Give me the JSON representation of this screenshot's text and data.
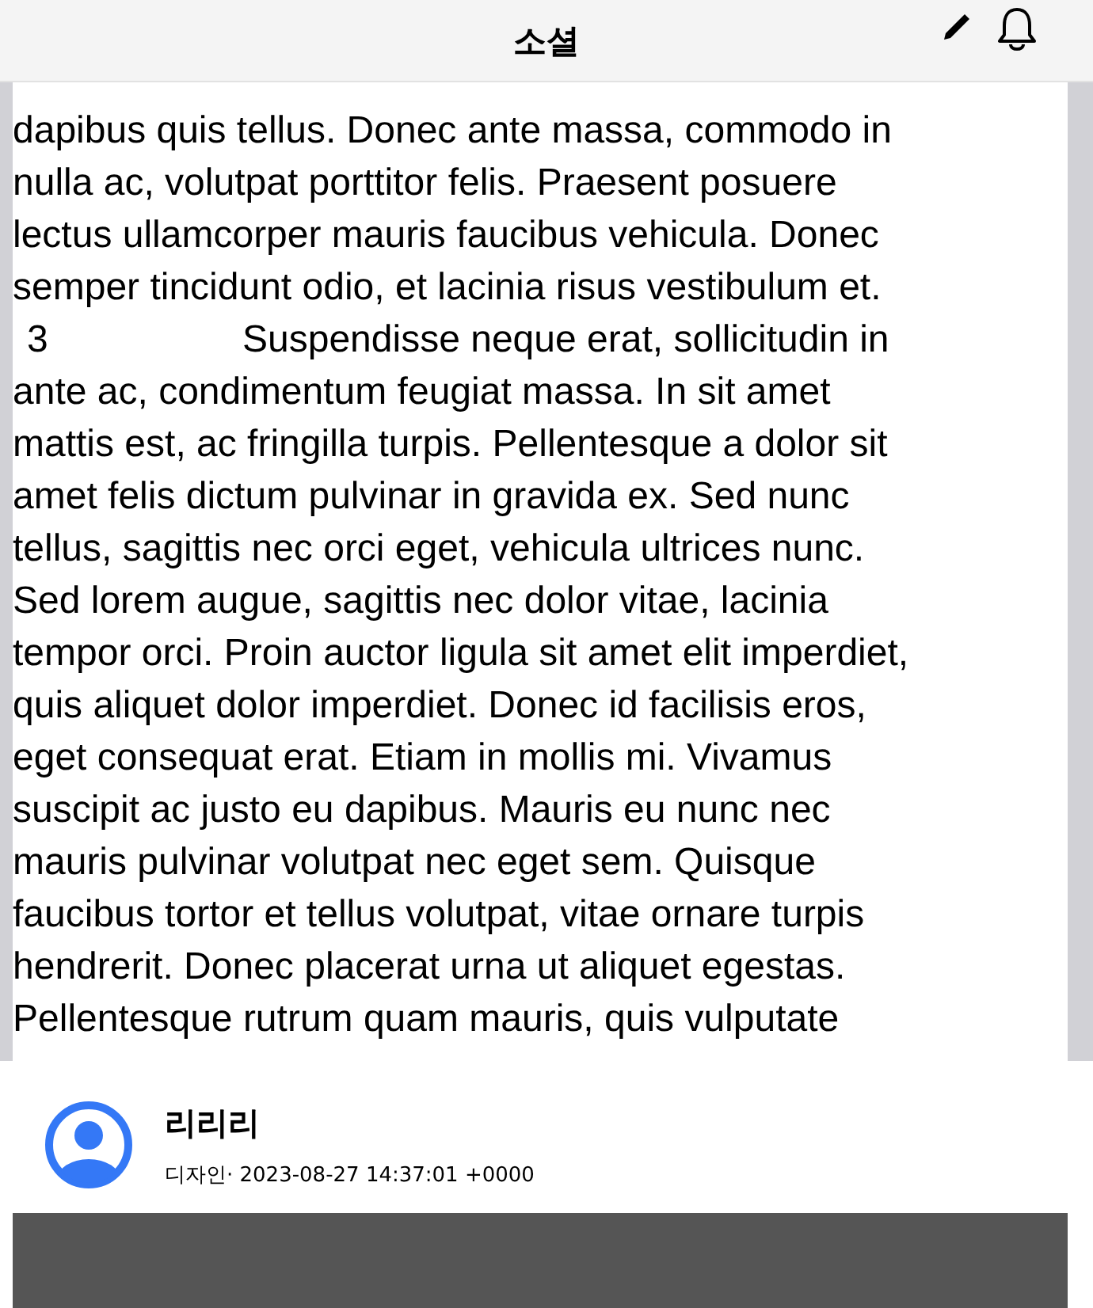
{
  "header": {
    "title": "소셜"
  },
  "article": {
    "lines": [
      {
        "text": "dapibus quis tellus. Donec ante massa, commodo in"
      },
      {
        "text": "nulla ac, volutpat porttitor felis. Praesent posuere"
      },
      {
        "text": "lectus ullamcorper mauris faucibus vehicula. Donec"
      },
      {
        "text": "semper tincidunt odio, et lacinia risus vestibulum et."
      },
      {
        "number": "3",
        "text": "Suspendisse neque erat, sollicitudin in"
      },
      {
        "text": "ante ac, condimentum feugiat massa. In sit amet"
      },
      {
        "text": "mattis est, ac fringilla turpis. Pellentesque a dolor sit"
      },
      {
        "text": "amet felis dictum pulvinar in gravida ex. Sed nunc"
      },
      {
        "text": "tellus, sagittis nec orci eget, vehicula ultrices nunc."
      },
      {
        "text": "Sed lorem augue, sagittis nec dolor vitae, lacinia"
      },
      {
        "text": "tempor orci. Proin auctor ligula sit amet elit imperdiet,"
      },
      {
        "text": "quis aliquet dolor imperdiet. Donec id facilisis eros,"
      },
      {
        "text": "eget consequat erat. Etiam in mollis mi. Vivamus"
      },
      {
        "text": "suscipit ac justo eu dapibus. Mauris eu nunc nec"
      },
      {
        "text": "mauris pulvinar volutpat nec eget sem. Quisque"
      },
      {
        "text": "faucibus tortor et tellus volutpat, vitae ornare turpis"
      },
      {
        "text": "hendrerit. Donec placerat urna ut aliquet egestas."
      },
      {
        "text": "Pellentesque rutrum quam mauris, quis vulputate"
      }
    ]
  },
  "post": {
    "author": "리리리",
    "meta": "디자인· 2023-08-27 14:37:01 +0000"
  }
}
